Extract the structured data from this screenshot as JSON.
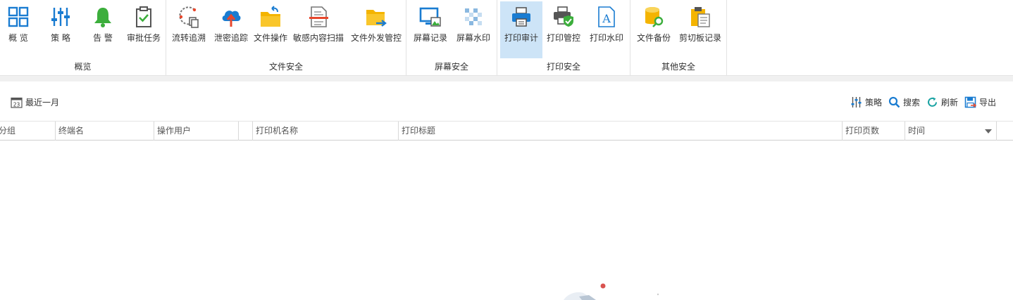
{
  "ribbon": {
    "groups": [
      {
        "label": "概览",
        "items": [
          "概 览",
          "策 略",
          "告 警",
          "审批任务"
        ]
      },
      {
        "label": "文件安全",
        "items": [
          "流转追溯",
          "泄密追踪",
          "文件操作",
          "敏感内容扫描",
          "文件外发管控"
        ]
      },
      {
        "label": "屏幕安全",
        "items": [
          "屏幕记录",
          "屏幕水印"
        ]
      },
      {
        "label": "打印安全",
        "items": [
          "打印审计",
          "打印管控",
          "打印水印"
        ]
      },
      {
        "label": "其他安全",
        "items": [
          "文件备份",
          "剪切板记录"
        ]
      }
    ],
    "active_item": "打印审计"
  },
  "toolbar": {
    "date_range": "最近一月",
    "date_icon_day": "23",
    "policy": "策略",
    "search": "搜索",
    "refresh": "刷新",
    "export": "导出"
  },
  "grid": {
    "columns": [
      "分组",
      "终端名",
      "操作用户",
      "",
      "打印机名称",
      "打印标题",
      "打印页数",
      "时间"
    ],
    "rows": []
  },
  "colors": {
    "accent": "#1a7cd1",
    "active_bg": "#cde4f7",
    "alert_green": "#3cae3c",
    "folder_yellow": "#f4b400",
    "upload_red": "#e8472c"
  }
}
